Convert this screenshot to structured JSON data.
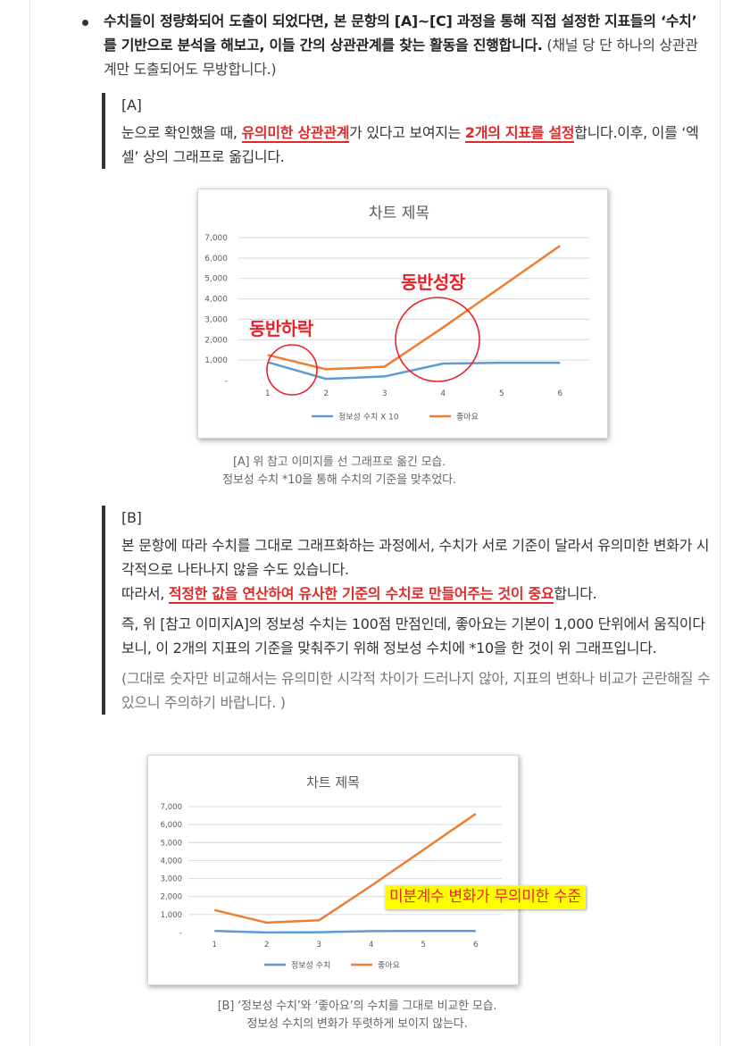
{
  "bullet": {
    "bold_text": "수치들이 정량화되어 도출이 되었다면, 본 문항의 [A]~[C] 과정을 통해 직접 설정한 지표들의 ‘수치’ 를 기반으로 분석을 해보고, 이들 간의 상관관계를 찾는 활동을 진행합니다.",
    "note": "(채널 당 단 하나의 상관관계만 도출되어도 무방합니다.)"
  },
  "section_a": {
    "label": "[A]",
    "line_prefix": "눈으로 확인했을 때, ",
    "highlight1": "유의미한 상관관계",
    "line_mid": "가 있다고 보여지는 ",
    "highlight2": "2개의 지표를 설정",
    "line_suffix": "합니다.이후, 이를 ‘엑셀’ 상의 그래프로 옮깁니다."
  },
  "section_b": {
    "label": "[B]",
    "p1": "본 문항에 따라 수치를 그대로 그래프화하는 과정에서, 수치가 서로 기준이 달라서 유의미한 변화가 시각적으로 나타나지 않을 수도 있습니다.",
    "p2_prefix": "따라서, ",
    "p2_highlight": "적정한 값을 연산하여 유사한 기준의 수치로 만들어주는 것이 중요",
    "p2_suffix": "합니다.",
    "p3": "즉, 위 [참고 이미지A]의 정보성 수치는 100점 만점인데, 좋아요는 기본이 1,000 단위에서 움직이다보니, 이 2개의 지표의 기준을 맞춰주기 위해 정보성 수치에 *10을 한 것이 위 그래프입니다.",
    "p4": "(그대로 숫자만 비교해서는 유의미한 시각적 차이가 드러나지 않아, 지표의 변화나 비교가 곤란해질 수 있으니 주의하기 바랍니다. )"
  },
  "annotations": {
    "a_low": "동반하락",
    "a_high": "동반성장",
    "b_warning": "미분계수 변화가 무의미한 수준"
  },
  "captions": {
    "a_line1": "[A] 위 참고 이미지를 선 그래프로 옮긴 모습.",
    "a_line2": "정보성 수치 *10을 통해 수치의 기준을 맞추었다.",
    "b_line1": "[B] ‘정보성 수치’와 ‘좋아요’의 수치를 그대로 비교한 모습.",
    "b_line2": "정보성 수치의 변화가 뚜렷하게 보이지 않는다."
  },
  "chart_data": [
    {
      "type": "line",
      "title": "차트 제목",
      "x": [
        1,
        2,
        3,
        4,
        5,
        6
      ],
      "yticks": [
        "7,000",
        "6,000",
        "5,000",
        "4,000",
        "3,000",
        "2,000",
        "1,000",
        "-"
      ],
      "ylim": [
        0,
        7000
      ],
      "series": [
        {
          "name": "정보성 수치 X 10",
          "color": "#5b9bd5",
          "values": [
            900,
            80,
            200,
            830,
            870,
            870
          ]
        },
        {
          "name": "좋아요",
          "color": "#ed7d31",
          "values": [
            1250,
            550,
            680,
            2600,
            4600,
            6600
          ]
        }
      ],
      "legend": "bottom",
      "grid": true
    },
    {
      "type": "line",
      "title": "차트 제목",
      "x": [
        1,
        2,
        3,
        4,
        5,
        6
      ],
      "yticks": [
        "7,000",
        "6,000",
        "5,000",
        "4,000",
        "3,000",
        "2,000",
        "1,000",
        "-"
      ],
      "ylim": [
        0,
        7000
      ],
      "series": [
        {
          "name": "정보성 수치",
          "color": "#5b9bd5",
          "values": [
            90,
            8,
            20,
            83,
            87,
            87
          ]
        },
        {
          "name": "좋아요",
          "color": "#ed7d31",
          "values": [
            1250,
            550,
            680,
            2600,
            4600,
            6600
          ]
        }
      ],
      "legend": "bottom",
      "grid": true
    }
  ]
}
